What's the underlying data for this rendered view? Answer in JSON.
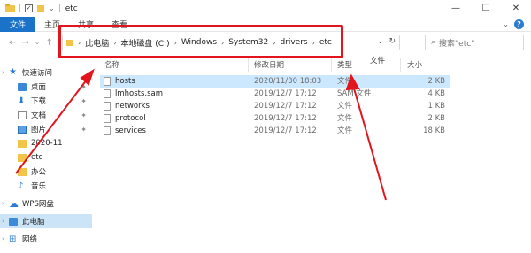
{
  "window": {
    "title": "etc",
    "qa_check": "✓",
    "minimize": "—",
    "maximize": "☐",
    "close": "✕"
  },
  "ribbon": {
    "tabs": [
      "文件",
      "主页",
      "共享",
      "查看"
    ],
    "chevron": "⌄",
    "help": "?"
  },
  "nav": {
    "back": "←",
    "forward": "→",
    "dropdown": "⌄",
    "up": "↑"
  },
  "address": {
    "separator": "›",
    "crumbs": [
      "此电脑",
      "本地磁盘 (C:)",
      "Windows",
      "System32",
      "drivers",
      "etc"
    ],
    "dropdown": "⌄",
    "refresh": "↻"
  },
  "search": {
    "placeholder": "搜索\"etc\"",
    "icon": "⌕"
  },
  "sidebar": {
    "items": [
      {
        "label": "快速访问",
        "icon": "star-icon"
      },
      {
        "label": "桌面",
        "icon": "desktop-icon"
      },
      {
        "label": "下载",
        "icon": "download-icon"
      },
      {
        "label": "文档",
        "icon": "document-icon"
      },
      {
        "label": "图片",
        "icon": "pictures-icon"
      },
      {
        "label": "2020-11",
        "icon": "folder-icon"
      },
      {
        "label": "etc",
        "icon": "folder-icon"
      },
      {
        "label": "办公",
        "icon": "folder-icon"
      },
      {
        "label": "音乐",
        "icon": "music-icon"
      },
      {
        "label": "WPS网盘",
        "icon": "cloud-icon"
      },
      {
        "label": "此电脑",
        "icon": "computer-icon"
      },
      {
        "label": "网络",
        "icon": "network-icon"
      }
    ],
    "pin": "📌",
    "expand": "›"
  },
  "columns": {
    "name": "名称",
    "date": "修改日期",
    "type": "类型",
    "size": "大小",
    "overlay": "文件"
  },
  "files": [
    {
      "name": "hosts",
      "date": "2020/11/30 18:03",
      "type": "文件",
      "size": "2 KB"
    },
    {
      "name": "lmhosts.sam",
      "date": "2019/12/7 17:12",
      "type": "SAM 文件",
      "size": "4 KB"
    },
    {
      "name": "networks",
      "date": "2019/12/7 17:12",
      "type": "文件",
      "size": "1 KB"
    },
    {
      "name": "protocol",
      "date": "2019/12/7 17:12",
      "type": "文件",
      "size": "2 KB"
    },
    {
      "name": "services",
      "date": "2019/12/7 17:12",
      "type": "文件",
      "size": "18 KB"
    }
  ],
  "annotation_color": "#e2151d",
  "selection_color": "#cce8ff",
  "accent_color": "#1a73c9"
}
